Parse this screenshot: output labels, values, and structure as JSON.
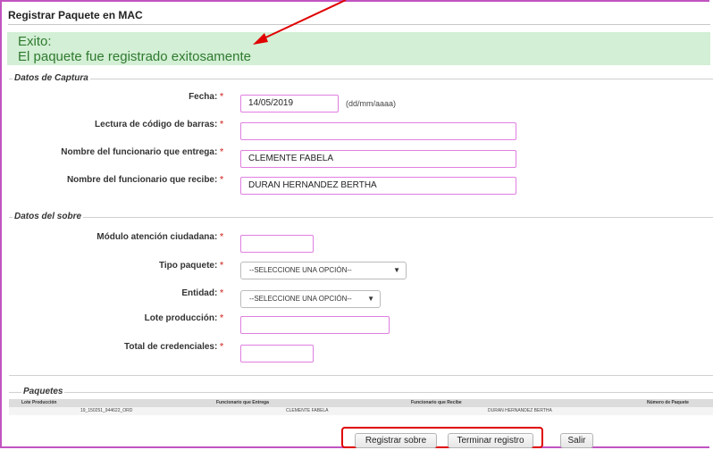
{
  "page_title": "Registrar Paquete en MAC",
  "success": {
    "heading": "Exito:",
    "message": "El paquete fue registrado exitosamente"
  },
  "capture": {
    "legend": "Datos de Captura",
    "fecha_label": "Fecha:",
    "fecha_value": "14/05/2019",
    "fecha_hint": "(dd/mm/aaaa)",
    "barcode_label": "Lectura de código de barras:",
    "barcode_value": "",
    "entrega_label": "Nombre del funcionario que entrega:",
    "entrega_value": "CLEMENTE FABELA",
    "recibe_label": "Nombre del funcionario que recibe:",
    "recibe_value": "DURAN HERNANDEZ BERTHA",
    "required_mark": "*"
  },
  "envelope": {
    "legend": "Datos del sobre",
    "modulo_label": "Módulo atención ciudadana:",
    "modulo_value": "",
    "tipo_label": "Tipo paquete:",
    "tipo_value": "--SELECCIONE UNA OPCIÓN--",
    "entidad_label": "Entidad:",
    "entidad_value": "--SELECCIONE UNA OPCIÓN--",
    "lote_label": "Lote producción:",
    "lote_value": "",
    "total_label": "Total de credenciales:",
    "total_value": ""
  },
  "packages": {
    "legend": "Paquetes",
    "columns": [
      "Lote Producción",
      "Funcionario que Entrega",
      "Funcionario que Recibe",
      "Número de Paquete"
    ],
    "rows": [
      {
        "lote": "19_150251_944622_ORD",
        "entrega": "CLEMENTE FABELA",
        "recibe": "DURAN HERNANDEZ BERTHA",
        "numero": ""
      }
    ]
  },
  "buttons": {
    "registrar": "Registrar sobre",
    "terminar": "Terminar registro",
    "salir": "Salir"
  },
  "colors": {
    "annotation_red": "#e00000",
    "success_bg": "#d3efd5",
    "success_text": "#2f7a2f",
    "input_border": "#e07fe0"
  }
}
